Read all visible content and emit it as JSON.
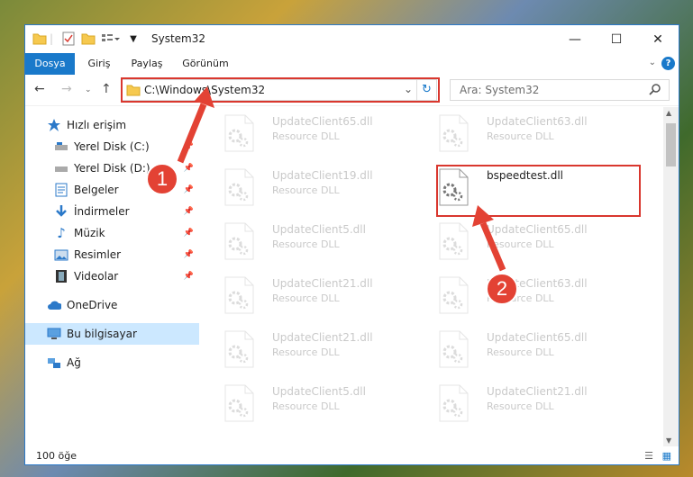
{
  "window": {
    "title": "System32",
    "minimize": "—",
    "maximize": "☐",
    "close": "✕"
  },
  "ribbon": {
    "tabs": [
      "Dosya",
      "Giriş",
      "Paylaş",
      "Görünüm"
    ],
    "help": "?"
  },
  "address": {
    "path": "C:\\Windows\\System32"
  },
  "search": {
    "placeholder": "Ara: System32"
  },
  "sidebar": {
    "quick_access": "Hızlı erişim",
    "items": [
      "Yerel Disk (C:)",
      "Yerel Disk (D:)",
      "Belgeler",
      "İndirmeler",
      "Müzik",
      "Resimler",
      "Videolar"
    ],
    "onedrive": "OneDrive",
    "this_pc": "Bu bilgisayar",
    "network": "Ağ"
  },
  "files": [
    {
      "name": "UpdateClient65.dll",
      "type": "Resource DLL",
      "faded": true
    },
    {
      "name": "UpdateClient63.dll",
      "type": "Resource DLL",
      "faded": true
    },
    {
      "name": "UpdateClient19.dll",
      "type": "Resource DLL",
      "faded": true
    },
    {
      "name": "bspeedtest.dll",
      "type": "",
      "faded": false
    },
    {
      "name": "UpdateClient5.dll",
      "type": "Resource DLL",
      "faded": true
    },
    {
      "name": "UpdateClient65.dll",
      "type": "Resource DLL",
      "faded": true
    },
    {
      "name": "UpdateClient21.dll",
      "type": "Resource DLL",
      "faded": true
    },
    {
      "name": "UpdateClient63.dll",
      "type": "Resource DLL",
      "faded": true
    },
    {
      "name": "UpdateClient21.dll",
      "type": "Resource DLL",
      "faded": true
    },
    {
      "name": "UpdateClient65.dll",
      "type": "Resource DLL",
      "faded": true
    },
    {
      "name": "UpdateClient5.dll",
      "type": "Resource DLL",
      "faded": true
    },
    {
      "name": "UpdateClient21.dll",
      "type": "Resource DLL",
      "faded": true
    }
  ],
  "status": {
    "count": "100 öğe"
  },
  "annotations": {
    "step1": "1",
    "step2": "2"
  },
  "colors": {
    "accent": "#1979ca",
    "highlight": "#d9372e"
  }
}
